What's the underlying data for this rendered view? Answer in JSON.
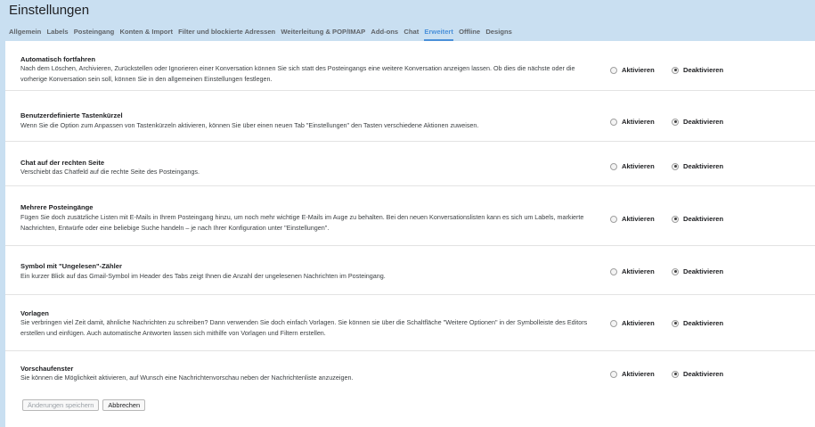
{
  "header": {
    "title": "Einstellungen"
  },
  "tabs": [
    {
      "label": "Allgemein",
      "active": false
    },
    {
      "label": "Labels",
      "active": false
    },
    {
      "label": "Posteingang",
      "active": false
    },
    {
      "label": "Konten & Import",
      "active": false
    },
    {
      "label": "Filter und blockierte Adressen",
      "active": false
    },
    {
      "label": "Weiterleitung & POP/IMAP",
      "active": false
    },
    {
      "label": "Add-ons",
      "active": false
    },
    {
      "label": "Chat",
      "active": false
    },
    {
      "label": "Erweitert",
      "active": true
    },
    {
      "label": "Offline",
      "active": false
    },
    {
      "label": "Designs",
      "active": false
    }
  ],
  "settings": [
    {
      "title": "Automatisch fortfahren",
      "description": "Nach dem Löschen, Archivieren, Zurückstellen oder Ignorieren einer Konversation können Sie sich statt des Posteingangs eine weitere Konversation anzeigen lassen. Ob dies die nächste oder die vorherige Konversation sein soll, können Sie in den allgemeinen Einstellungen festlegen.",
      "enable_label": "Aktivieren",
      "disable_label": "Deaktivieren",
      "selected": "disable"
    },
    {
      "title": "Benutzerdefinierte Tastenkürzel",
      "description": "Wenn Sie die Option zum Anpassen von Tastenkürzeln aktivieren, können Sie über einen neuen Tab \"Einstellungen\" den Tasten verschiedene Aktionen zuweisen.",
      "enable_label": "Aktivieren",
      "disable_label": "Deaktivieren",
      "selected": "disable"
    },
    {
      "title": "Chat auf der rechten Seite",
      "description": "Verschiebt das Chatfeld auf die rechte Seite des Posteingangs.",
      "enable_label": "Aktivieren",
      "disable_label": "Deaktivieren",
      "selected": "disable"
    },
    {
      "title": "Mehrere Posteingänge",
      "description": "Fügen Sie doch zusätzliche Listen mit E-Mails in Ihrem Posteingang hinzu, um noch mehr wichtige E-Mails im Auge zu behalten. Bei den neuen Konversationslisten kann es sich um Labels, markierte Nachrichten, Entwürfe oder eine beliebige Suche handeln – je nach Ihrer Konfiguration unter \"Einstellungen\".",
      "enable_label": "Aktivieren",
      "disable_label": "Deaktivieren",
      "selected": "disable"
    },
    {
      "title": "Symbol mit \"Ungelesen\"-Zähler",
      "description": "Ein kurzer Blick auf das Gmail-Symbol im Header des Tabs zeigt Ihnen die Anzahl der ungelesenen Nachrichten im Posteingang.",
      "enable_label": "Aktivieren",
      "disable_label": "Deaktivieren",
      "selected": "disable"
    },
    {
      "title": "Vorlagen",
      "description": "Sie verbringen viel Zeit damit, ähnliche Nachrichten zu schreiben? Dann verwenden Sie doch einfach Vorlagen. Sie können sie über die Schaltfläche \"Weitere Optionen\" in der Symbolleiste des Editors erstellen und einfügen. Auch automatische Antworten lassen sich mithilfe von Vorlagen und Filtern erstellen.",
      "enable_label": "Aktivieren",
      "disable_label": "Deaktivieren",
      "selected": "disable"
    },
    {
      "title": "Vorschaufenster",
      "description": "Sie können die Möglichkeit aktivieren, auf Wunsch eine Nachrichtenvorschau neben der Nachrichtenliste anzuzeigen.",
      "enable_label": "Aktivieren",
      "disable_label": "Deaktivieren",
      "selected": "disable"
    }
  ],
  "footer": {
    "save_label": "Änderungen speichern",
    "cancel_label": "Abbrechen"
  }
}
